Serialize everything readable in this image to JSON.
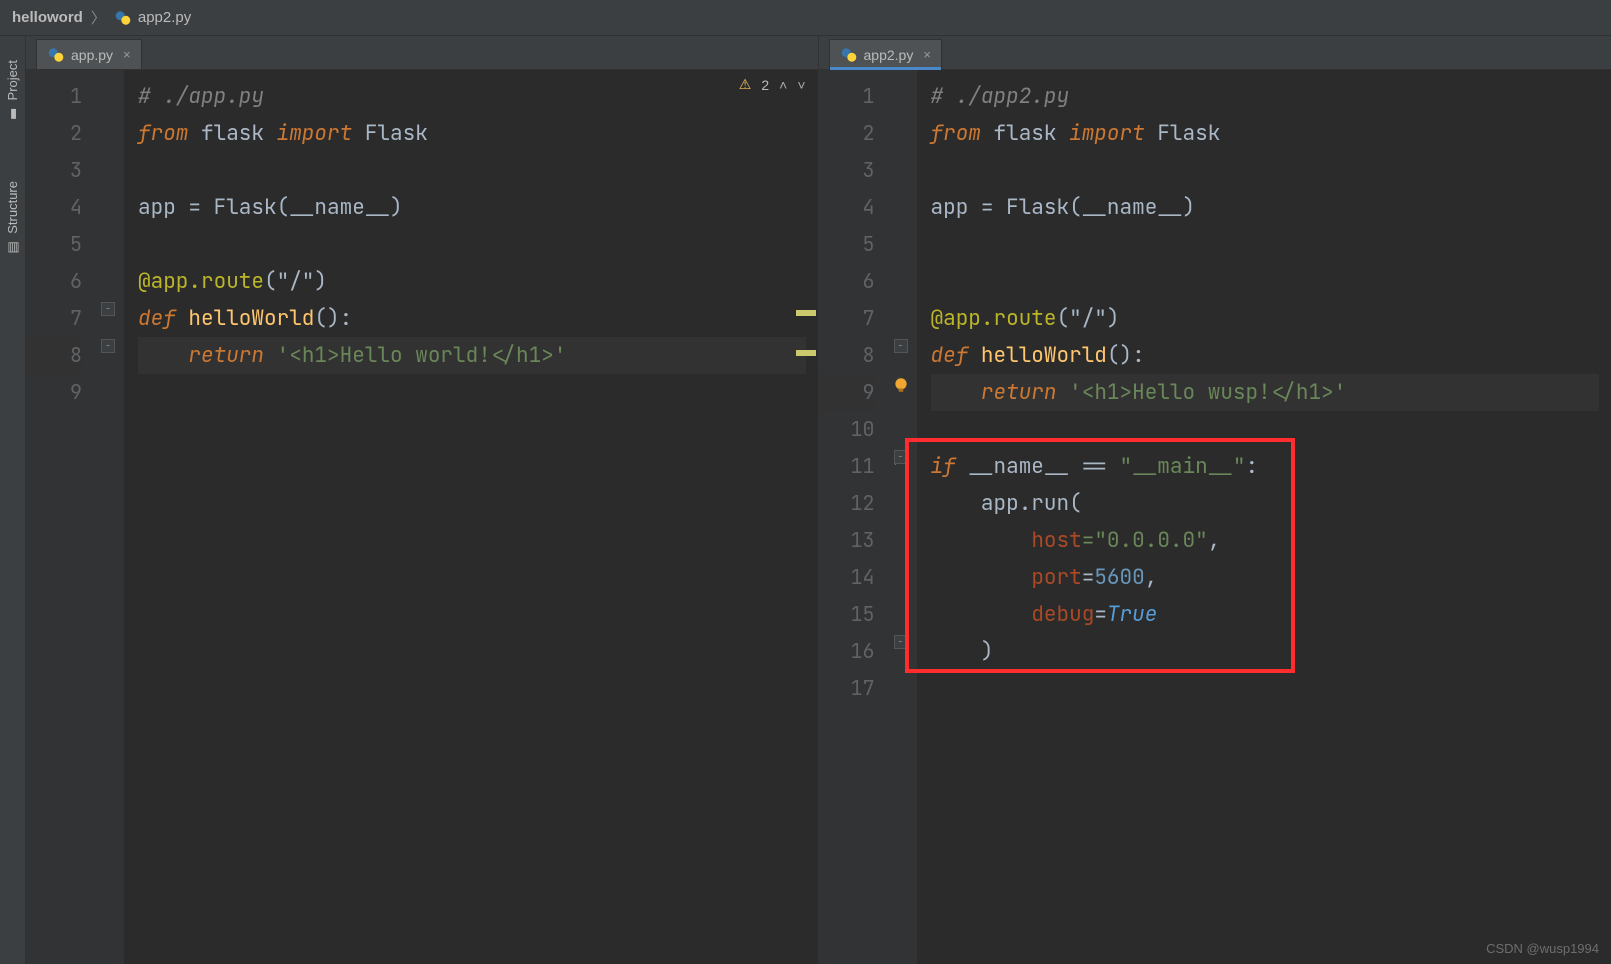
{
  "breadcrumb": {
    "project": "helloword",
    "file": "app2.py"
  },
  "sidebar": {
    "project": "Project",
    "structure": "Structure"
  },
  "left": {
    "tab": "app.py",
    "inspection_count": "2",
    "lines": [
      "1",
      "2",
      "3",
      "4",
      "5",
      "6",
      "7",
      "8",
      "9"
    ],
    "c1": "# ./app.py",
    "c2_from": "from",
    "c2_flask": " flask ",
    "c2_import": "import",
    "c2_Flask": " Flask",
    "c4": "app = Flask(__name__)",
    "c6_dec": "@app.route",
    "c6_args": "(\"/\")",
    "c7_def": "def",
    "c7_name": " helloWorld",
    "c7_rest": "():",
    "c8_ret": "return",
    "c8_str": " '<h1>Hello world!</h1>'"
  },
  "right": {
    "tab": "app2.py",
    "lines": [
      "1",
      "2",
      "3",
      "4",
      "5",
      "6",
      "7",
      "8",
      "9",
      "10",
      "11",
      "12",
      "13",
      "14",
      "15",
      "16",
      "17"
    ],
    "c1": "# ./app2.py",
    "c2_from": "from",
    "c2_flask": " flask ",
    "c2_import": "import",
    "c2_Flask": " Flask",
    "c4": "app = Flask(__name__)",
    "c7_dec": "@app.route",
    "c7_args": "(\"/\")",
    "c8_def": "def",
    "c8_name": " helloWorld",
    "c8_rest": "():",
    "c9_ret": "return",
    "c9_str": " '<h1>Hello wusp!</h1>'",
    "c11_if": "if",
    "c11_name": " __name__ ",
    "c11_eq": "==",
    "c11_main": " \"__main__\"",
    "c11_colon": ":",
    "c12": "    app.run(",
    "c13_k": "host",
    "c13_v": "=\"0.0.0.0\"",
    "c13_comma": ",",
    "c14_k": "port",
    "c14_v": "=",
    "c14_num": "5600",
    "c14_comma": ",",
    "c15_k": "debug",
    "c15_v": "=",
    "c15_true": "True",
    "c16": "    )"
  },
  "watermark": "CSDN @wusp1994"
}
